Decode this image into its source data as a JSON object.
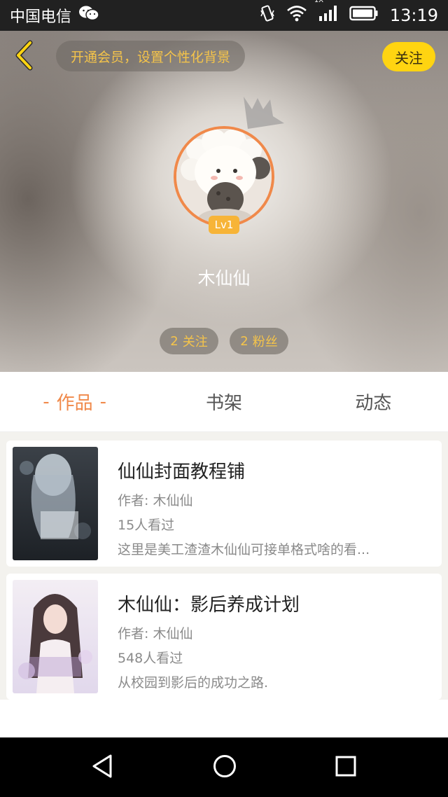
{
  "status_bar": {
    "carrier": "中国电信",
    "time": "13:19",
    "network_label": "1X"
  },
  "header": {
    "vip_text": "开通会员，设置个性化背景",
    "follow_label": "关注",
    "level": "Lv1",
    "username": "木仙仙",
    "following_count": "2",
    "following_label": "关注",
    "fans_count": "2",
    "fans_label": "粉丝"
  },
  "tabs": [
    {
      "label": "作品",
      "active": true
    },
    {
      "label": "书架",
      "active": false
    },
    {
      "label": "动态",
      "active": false
    }
  ],
  "works": [
    {
      "title": "仙仙封面教程铺",
      "author": "作者: 木仙仙",
      "views": "15人看过",
      "desc": "这里是美工渣渣木仙仙可接单格式啥的看..."
    },
    {
      "title": "木仙仙：影后养成计划",
      "author": "作者: 木仙仙",
      "views": "548人看过",
      "desc": "从校园到影后的成功之路."
    }
  ],
  "colors": {
    "accent_orange": "#f0894a",
    "follow_yellow": "#ffd411",
    "vip_text_gold": "#f5c44a",
    "level_badge": "#f7b437"
  },
  "icons": [
    "back-icon",
    "wechat-icon",
    "vibrate-icon",
    "wifi-icon",
    "signal-icon",
    "battery-icon",
    "crown-icon",
    "nav-back-icon",
    "nav-home-icon",
    "nav-recents-icon"
  ]
}
